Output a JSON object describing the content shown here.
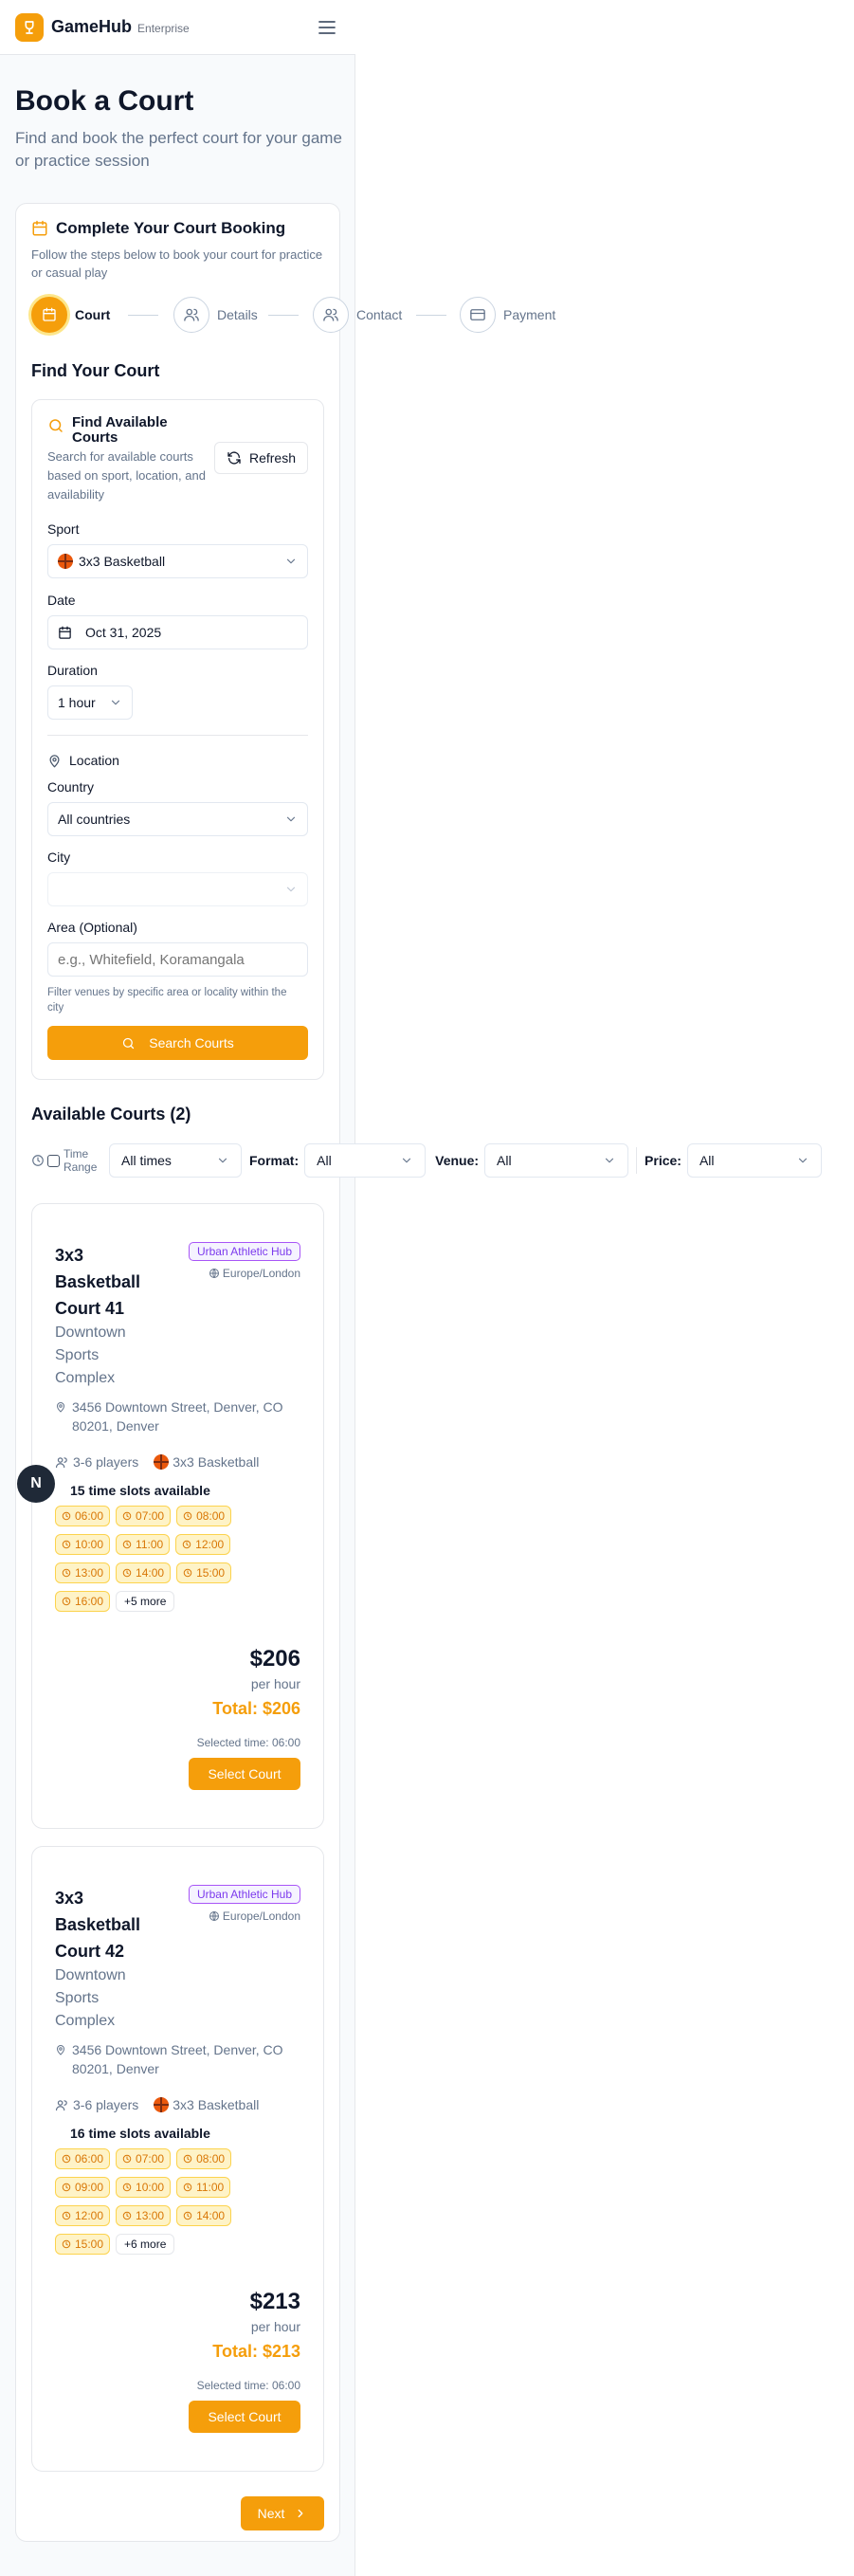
{
  "header": {
    "brand": "GameHub",
    "brand_sub": "Enterprise"
  },
  "page": {
    "title": "Book a Court",
    "subtitle": "Find and book the perfect court for your game or practice session"
  },
  "booking": {
    "title": "Complete Your Court Booking",
    "description": "Follow the steps below to book your court for practice or casual play",
    "steps": [
      {
        "label": "Court",
        "icon": "calendar-icon",
        "active": true
      },
      {
        "label": "Details",
        "icon": "users-icon",
        "active": false
      },
      {
        "label": "Contact",
        "icon": "users-icon",
        "active": false
      },
      {
        "label": "Payment",
        "icon": "credit-card-icon",
        "active": false
      }
    ],
    "find_title": "Find Your Court"
  },
  "search": {
    "title": "Find Available Courts",
    "description": "Search for available courts based on sport, location, and availability",
    "refresh_label": "Refresh",
    "sport_label": "Sport",
    "sport_value": "3x3 Basketball",
    "date_label": "Date",
    "date_value": "Oct 31, 2025",
    "duration_label": "Duration",
    "duration_value": "1 hour",
    "location_label": "Location",
    "country_label": "Country",
    "country_value": "All countries",
    "city_label": "City",
    "city_value": "",
    "area_label": "Area (Optional)",
    "area_placeholder": "e.g., Whitefield, Koramangala",
    "area_hint": "Filter venues by specific area or locality within the city",
    "search_button": "Search Courts"
  },
  "results": {
    "title": "Available Courts (2)",
    "filters": {
      "time_range_label": "Time Range",
      "time_value": "All times",
      "format_label": "Format:",
      "format_value": "All",
      "venue_label": "Venue:",
      "venue_value": "All",
      "price_label": "Price:",
      "price_value": "All"
    },
    "courts": [
      {
        "name": "3x3 Basketball Court 41",
        "venue": "Downtown Sports Complex",
        "badge": "Urban Athletic Hub",
        "timezone": "Europe/London",
        "address": "3456 Downtown Street, Denver, CO 80201, Denver",
        "players": "3-6 players",
        "sport": "3x3 Basketball",
        "slots_title": "15 time slots available",
        "slots": [
          "06:00",
          "07:00",
          "08:00",
          "10:00",
          "11:00",
          "12:00",
          "13:00",
          "14:00",
          "15:00",
          "16:00"
        ],
        "more": "+5 more",
        "price": "$206",
        "per": "per hour",
        "total": "Total: $206",
        "selected_time": "Selected time: 06:00",
        "button": "Select Court"
      },
      {
        "name": "3x3 Basketball Court 42",
        "venue": "Downtown Sports Complex",
        "badge": "Urban Athletic Hub",
        "timezone": "Europe/London",
        "address": "3456 Downtown Street, Denver, CO 80201, Denver",
        "players": "3-6 players",
        "sport": "3x3 Basketball",
        "slots_title": "16 time slots available",
        "slots": [
          "06:00",
          "07:00",
          "08:00",
          "09:00",
          "10:00",
          "11:00",
          "12:00",
          "13:00",
          "14:00",
          "15:00"
        ],
        "more": "+6 more",
        "price": "$213",
        "per": "per hour",
        "total": "Total: $213",
        "selected_time": "Selected time: 06:00",
        "button": "Select Court"
      }
    ]
  },
  "next_button": "Next",
  "floating_badge": "N",
  "colors": {
    "accent": "#f59e0b",
    "badge_purple": "#7c3aed",
    "text": "#0f172a",
    "muted": "#64748b"
  }
}
